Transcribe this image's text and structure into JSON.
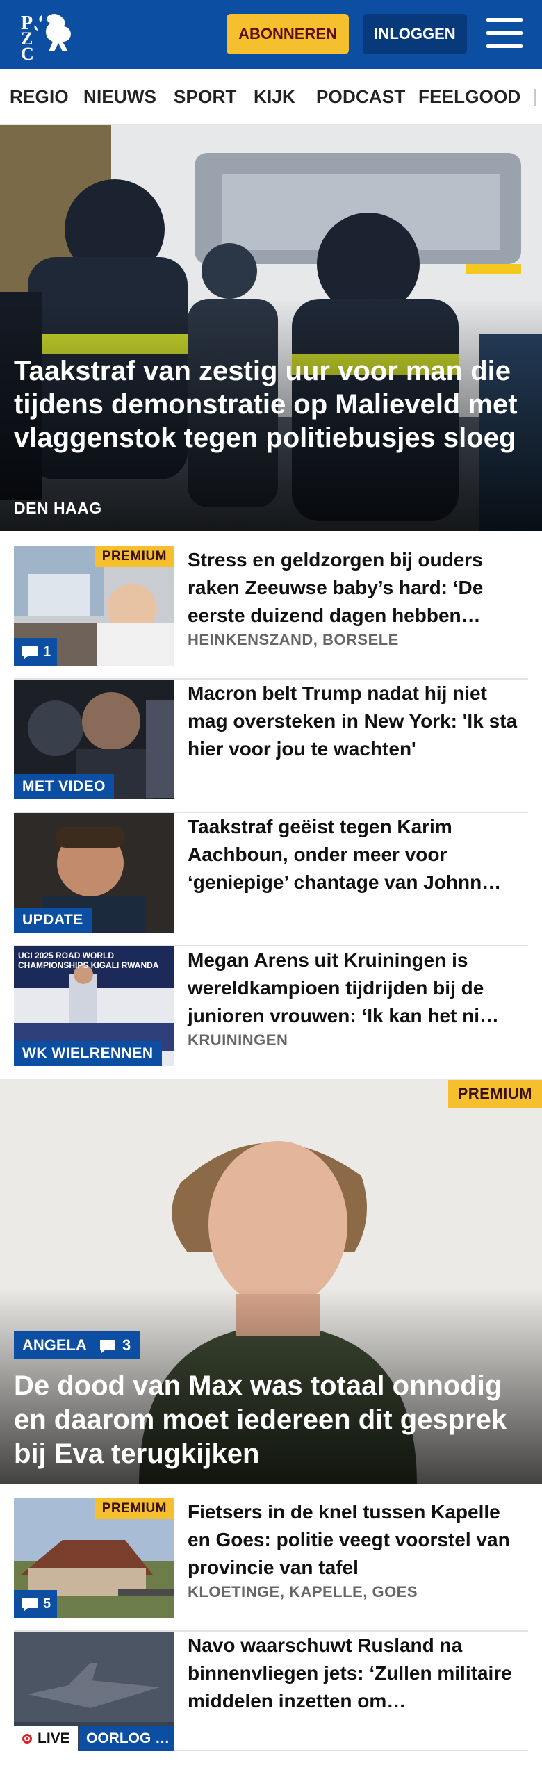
{
  "header": {
    "logo_text": "PZC",
    "subscribe_label": "ABONNEREN",
    "login_label": "INLOGGEN",
    "brand_color": "#0b4ea2",
    "accent_color": "#f5bf2e"
  },
  "nav": {
    "items": [
      {
        "label": "REGIO"
      },
      {
        "label": "NIEUWS"
      },
      {
        "label": "SPORT"
      },
      {
        "label": "KIJK"
      },
      {
        "label": "PODCAST"
      },
      {
        "label": "FEELGOOD"
      }
    ]
  },
  "hero": {
    "title": "Taakstraf van zestig uur voor man die tijdens demonstratie op Malieveld met vlaggenstok tegen politiebusjes sloeg",
    "location": "DEN HAAG"
  },
  "articles": [
    {
      "title": "Stress en geldzorgen bij ouders raken Zeeuwse baby’s hard: ‘De eerste duizend dagen hebben…",
      "location": "HEINKENSZAND, BORSELE",
      "premium": "PREMIUM",
      "comments": "1"
    },
    {
      "title": "Macron belt Trump nadat hij niet mag oversteken in New York: 'Ik sta hier voor jou te wachten'",
      "label": "MET VIDEO"
    },
    {
      "title": "Taakstraf geëist tegen Karim Aachboun, onder meer voor ‘geniepige’ chantage van Johnn…",
      "label": "UPDATE"
    },
    {
      "title": "Megan Arens uit Kruiningen is wereldkampioen tijdrijden bij de junioren vrouwen: ‘Ik kan het ni…",
      "location": "KRUININGEN",
      "label": "WK WIELRENNEN",
      "thumb_text": "UCI 2025 ROAD WORLD CHAMPIONSHIPS KIGALI RWANDA"
    }
  ],
  "feature": {
    "premium": "PREMIUM",
    "tag": "ANGELA",
    "comments": "3",
    "title": "De dood van Max was totaal onnodig en daarom moet iedereen dit gesprek bij Eva terugkijken"
  },
  "articles2": [
    {
      "title": "Fietsers in de knel tussen Kapelle en Goes: politie veegt voorstel van provincie van tafel",
      "location": "KLOETINGE, KAPELLE, GOES",
      "premium": "PREMIUM",
      "comments": "5"
    },
    {
      "title": "Navo waarschuwt Rusland na binnenvliegen jets: ‘Zullen militaire middelen inzetten om…",
      "live": "LIVE",
      "label": "OORLOG …"
    }
  ]
}
